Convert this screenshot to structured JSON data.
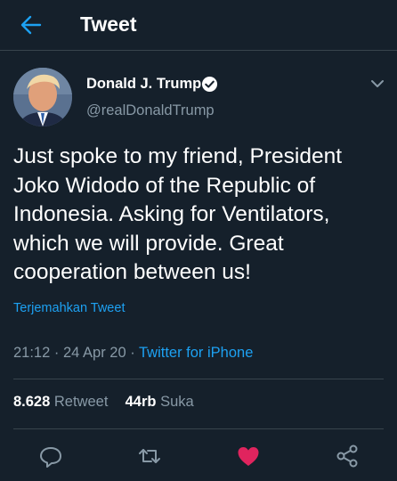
{
  "header": {
    "title": "Tweet"
  },
  "author": {
    "name": "Donald J. Trump",
    "handle": "@realDonaldTrump"
  },
  "tweet": {
    "text": "Just spoke to my friend, President Joko Widodo of the Republic of Indonesia. Asking for Ventilators, which we will provide. Great cooperation between us!",
    "translate_label": "Terjemahkan Tweet",
    "time": "21:12",
    "date": "24 Apr 20",
    "source": "Twitter for iPhone"
  },
  "stats": {
    "retweets": "8.628",
    "retweets_label": "Retweet",
    "likes": "44rb",
    "likes_label": "Suka"
  },
  "colors": {
    "accent": "#1da1f2",
    "background": "#15202b",
    "like": "#e0245e",
    "muted": "#8899a6"
  },
  "icons": [
    "back-arrow-icon",
    "verified-badge-icon",
    "chevron-down-icon",
    "reply-icon",
    "retweet-icon",
    "heart-icon",
    "share-icon"
  ]
}
